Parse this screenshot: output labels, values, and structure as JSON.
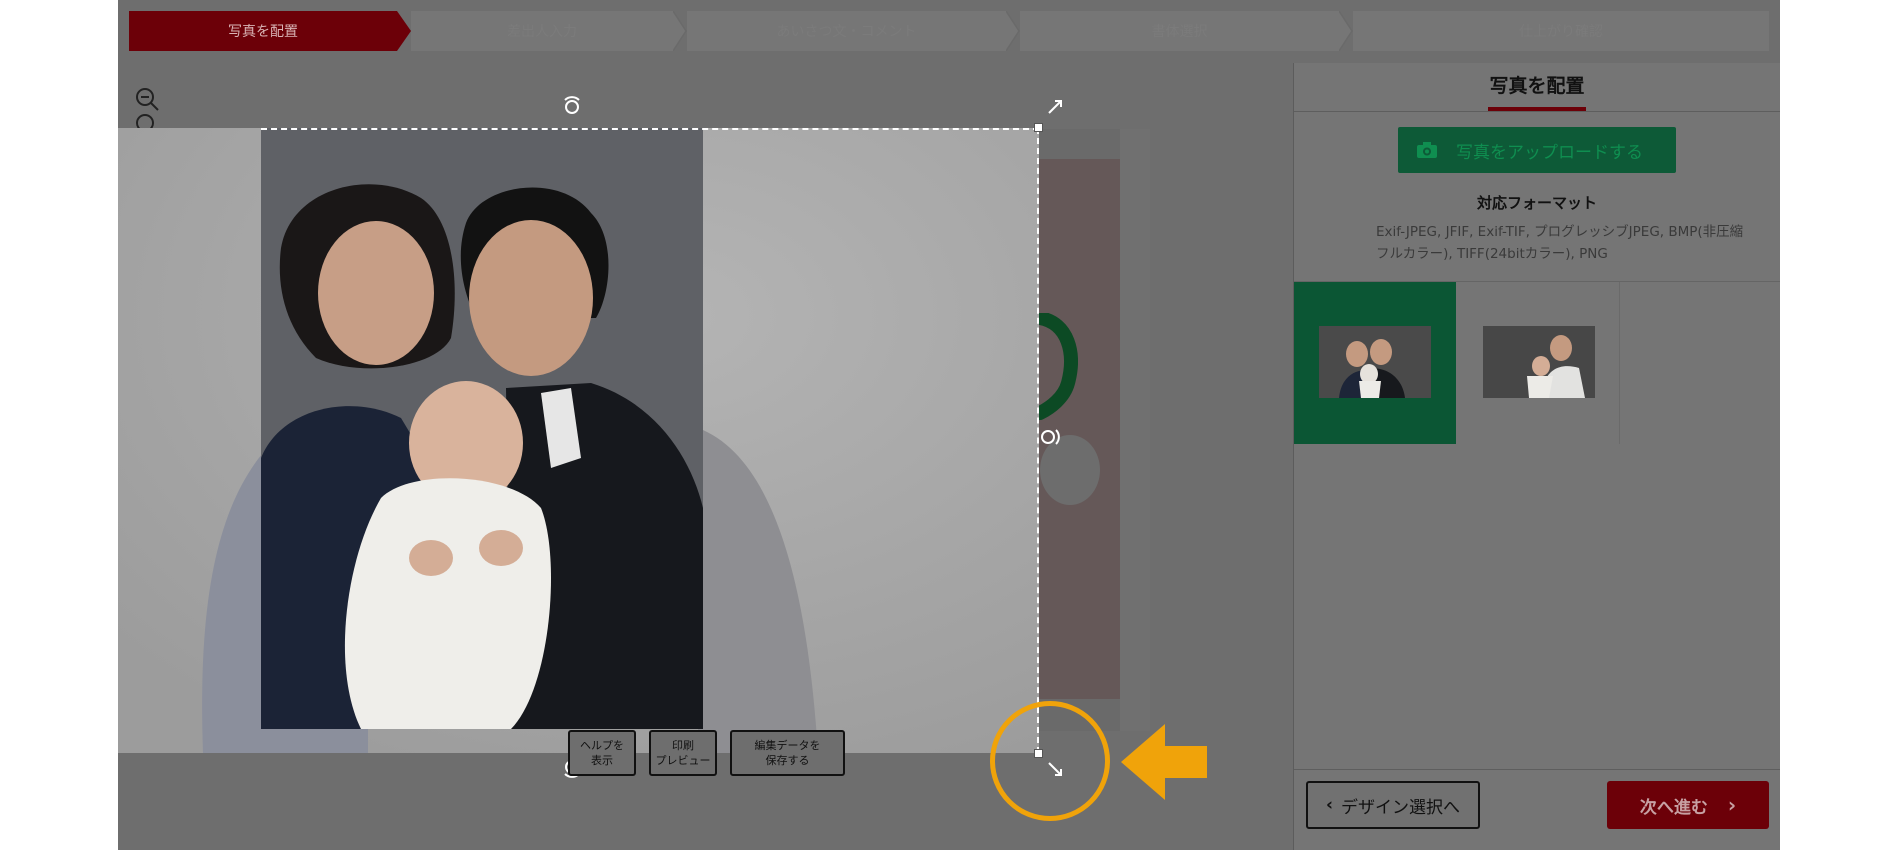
{
  "steps": [
    {
      "label": "写真を配置",
      "active": true
    },
    {
      "label": "差出人入力",
      "active": false
    },
    {
      "label": "あいさつ文・コメント",
      "active": false
    },
    {
      "label": "書体選択",
      "active": false
    },
    {
      "label": "仕上がり確認",
      "active": false
    }
  ],
  "toolbar": {
    "help_label": "ヘルプを\n表示",
    "preview_label": "印刷\nプレビュー",
    "save_label": "編集データを\n保存する"
  },
  "panel": {
    "title": "写真を配置",
    "upload_label": "写真をアップロードする",
    "formats_title": "対応フォーマット",
    "formats_text": "Exif-JPEG, JFIF, Exif-TIF, プログレッシブJPEG, BMP(非圧縮フルカラー), TIFF(24bitカラー), PNG",
    "back_label": "デザイン選択へ",
    "next_label": "次へ進む"
  },
  "icons": {
    "zoom_out": "zoom-out-icon",
    "zoom_in": "zoom-in-icon",
    "camera": "camera-icon",
    "rotate": "rotate-icon",
    "resize": "resize-icon"
  },
  "colors": {
    "step_active": "#6c0008",
    "upload_green": "#0d5a37",
    "highlight": "#f0a30a"
  }
}
